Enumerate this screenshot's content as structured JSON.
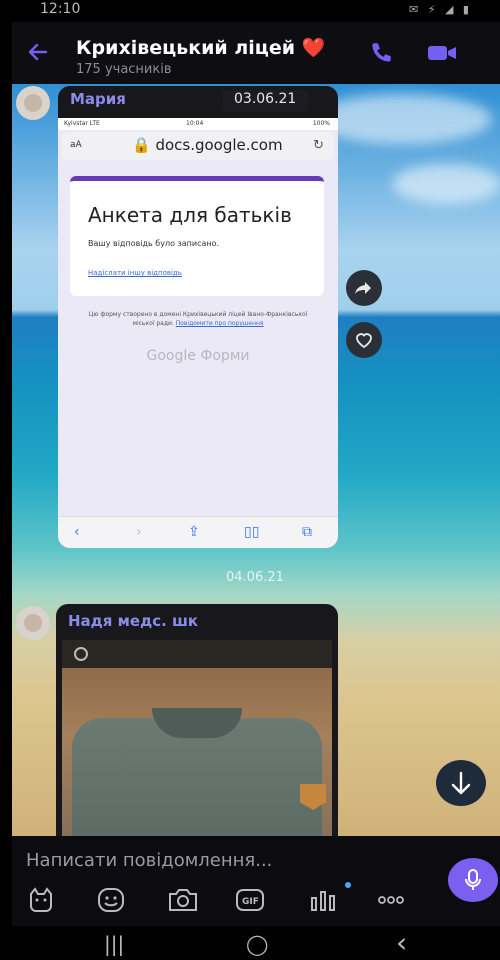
{
  "status_bar": {
    "time": "12:10",
    "icons": "✉ ⚡ ◢ ▮"
  },
  "header": {
    "title": "Крихівецький ліцей",
    "title_emoji": "❤️",
    "subtitle": "175 учасників",
    "icons": [
      "back-arrow-icon",
      "phone-icon",
      "video-call-icon"
    ],
    "accent": "#7360f2"
  },
  "messages": [
    {
      "sender": "Мария",
      "date": "03.06.21",
      "screenshot": {
        "carrier": "Kyivstar  LTE",
        "clock": "10:04",
        "battery": "100%",
        "url_prefix": "aA",
        "url": "docs.google.com",
        "form_title": "Анкета для батьків",
        "form_note": "Вашу відповідь було записано.",
        "form_link": "Надіслати іншу відповідь",
        "footer_text": "Цю форму створено в домені Крихівецький ліцей Івано-Франківської міської ради.",
        "footer_link": "Повідомити про порушення",
        "brand": "Google Форми"
      }
    },
    {
      "sender": "Надя медс. шк",
      "content": "photo"
    }
  ],
  "day_label": "04.06.21",
  "compose": {
    "placeholder": "Написати повідомлення...",
    "tools": [
      "sticker-icon",
      "emoji-icon",
      "camera-icon",
      "gif-icon",
      "poll-icon",
      "more-icon"
    ]
  },
  "navbar": {
    "recents": "|||",
    "home": "◯",
    "back": "‹"
  }
}
